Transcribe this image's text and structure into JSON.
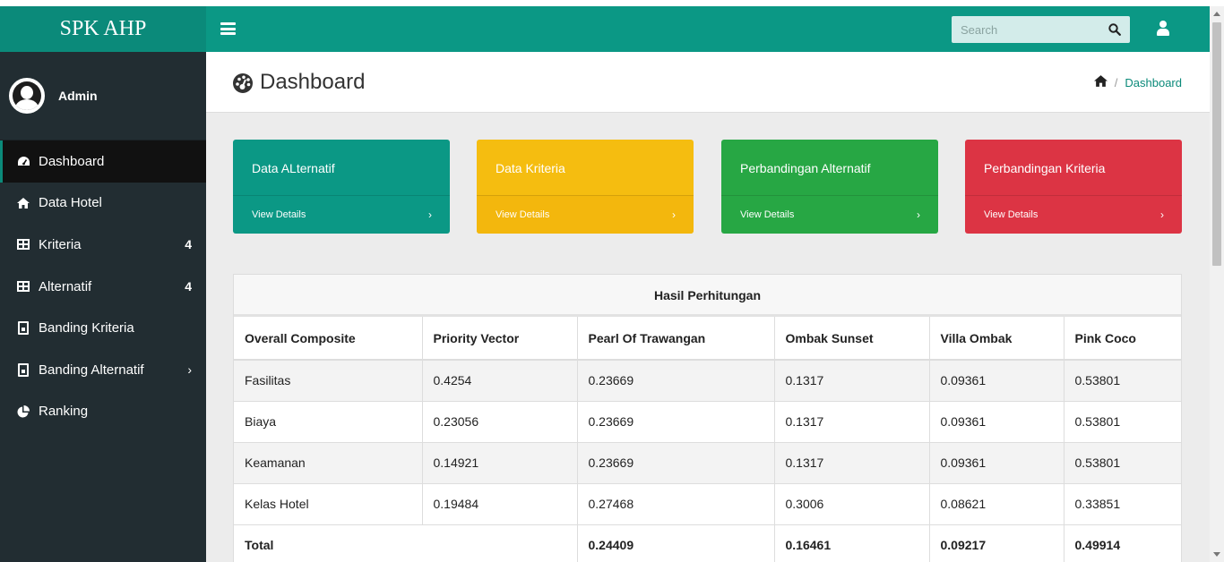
{
  "brand": "SPK AHP",
  "user": {
    "name": "Admin"
  },
  "sidebar": {
    "items": [
      {
        "label": "Dashboard",
        "icon": "gauge-icon",
        "badge": ""
      },
      {
        "label": "Data Hotel",
        "icon": "home-icon",
        "badge": ""
      },
      {
        "label": "Kriteria",
        "icon": "table-icon",
        "badge": "4"
      },
      {
        "label": "Alternatif",
        "icon": "table-icon",
        "badge": "4"
      },
      {
        "label": "Banding Kriteria",
        "icon": "file-chart-icon",
        "badge": ""
      },
      {
        "label": "Banding Alternatif",
        "icon": "file-chart-icon",
        "badge": ""
      },
      {
        "label": "Ranking",
        "icon": "pie-chart-icon",
        "badge": ""
      }
    ]
  },
  "header": {
    "search_placeholder": "Search"
  },
  "page": {
    "title": "Dashboard",
    "breadcrumb": "Dashboard"
  },
  "cards": [
    {
      "title": "Data ALternatif",
      "link": "View Details",
      "color": "#0b9885"
    },
    {
      "title": "Data Kriteria",
      "link": "View Details",
      "color": "#f5bd10"
    },
    {
      "title": "Perbandingan Alternatif",
      "link": "View Details",
      "color": "#27a744"
    },
    {
      "title": "Perbandingan Kriteria",
      "link": "View Details",
      "color": "#dc3444"
    }
  ],
  "table": {
    "title": "Hasil Perhitungan",
    "headers": [
      "Overall Composite",
      "Priority Vector",
      "Pearl Of Trawangan",
      "Ombak Sunset",
      "Villa Ombak",
      "Pink Coco"
    ],
    "rows": [
      [
        "Fasilitas",
        "0.4254",
        "0.23669",
        "0.1317",
        "0.09361",
        "0.53801"
      ],
      [
        "Biaya",
        "0.23056",
        "0.23669",
        "0.1317",
        "0.09361",
        "0.53801"
      ],
      [
        "Keamanan",
        "0.14921",
        "0.23669",
        "0.1317",
        "0.09361",
        "0.53801"
      ],
      [
        "Kelas Hotel",
        "0.19484",
        "0.27468",
        "0.3006",
        "0.08621",
        "0.33851"
      ]
    ],
    "total": {
      "label": "Total",
      "values": [
        "0.24409",
        "0.16461",
        "0.09217",
        "0.49914"
      ]
    }
  }
}
